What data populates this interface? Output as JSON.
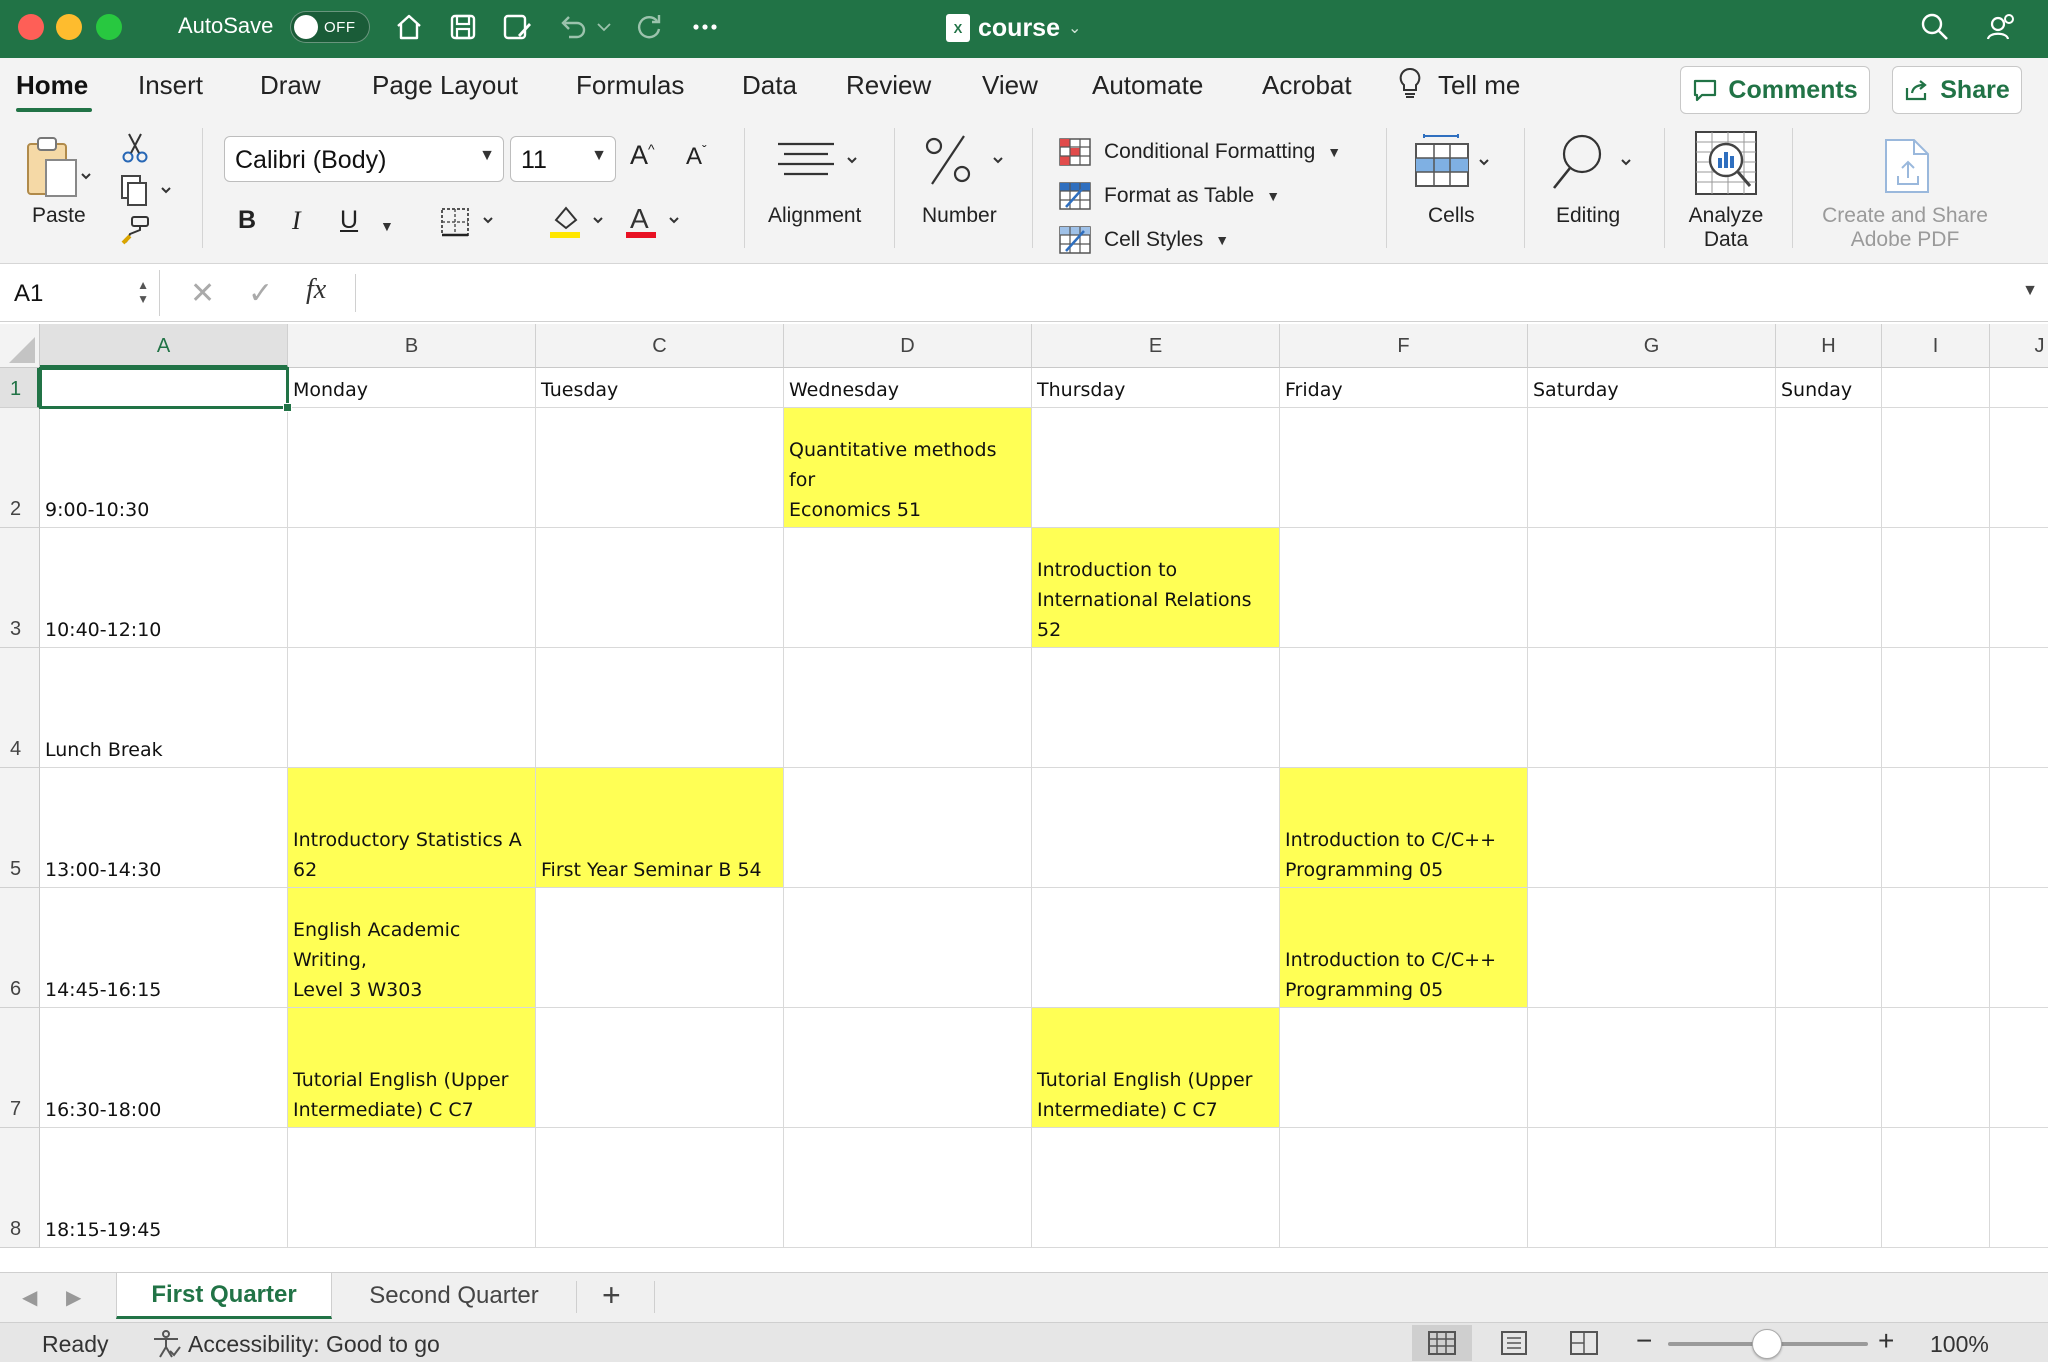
{
  "window": {
    "title": "course",
    "autosave_label": "AutoSave",
    "autosave_state": "OFF"
  },
  "ribbon_tabs": [
    {
      "label": "Home",
      "active": true
    },
    {
      "label": "Insert"
    },
    {
      "label": "Draw"
    },
    {
      "label": "Page Layout"
    },
    {
      "label": "Formulas"
    },
    {
      "label": "Data"
    },
    {
      "label": "Review"
    },
    {
      "label": "View"
    },
    {
      "label": "Automate"
    },
    {
      "label": "Acrobat"
    },
    {
      "label": "Tell me"
    }
  ],
  "ribbon_buttons": {
    "comments": "Comments",
    "share": "Share"
  },
  "ribbon": {
    "paste": "Paste",
    "font_name": "Calibri (Body)",
    "font_size": "11",
    "bold": "B",
    "italic": "I",
    "underline": "U",
    "alignment": "Alignment",
    "number": "Number",
    "conditional_formatting": "Conditional Formatting",
    "format_as_table": "Format as Table",
    "cell_styles": "Cell Styles",
    "cells": "Cells",
    "editing": "Editing",
    "analyze_data": "Analyze Data",
    "adobe_pdf": "Create and Share Adobe PDF"
  },
  "formula_bar": {
    "name_box": "A1",
    "fx": "fx",
    "content": ""
  },
  "columns": [
    "A",
    "B",
    "C",
    "D",
    "E",
    "F",
    "G",
    "H",
    "I",
    "J"
  ],
  "rows": [
    "1",
    "2",
    "3",
    "4",
    "5",
    "6",
    "7",
    "8"
  ],
  "sheet": {
    "days": [
      "Monday",
      "Tuesday",
      "Wednesday",
      "Thursday",
      "Friday",
      "Saturday",
      "Sunday"
    ],
    "times": [
      "9:00-10:30",
      "10:40-12:10",
      "Lunch Break",
      "13:00-14:30",
      "14:45-16:15",
      "16:30-18:00",
      "18:15-19:45"
    ],
    "classes": [
      {
        "cell": "D2",
        "text": "Quantitative methods for\nEconomics 51"
      },
      {
        "cell": "E3",
        "text": "Introduction to\nInternational Relations 52"
      },
      {
        "cell": "B5",
        "text": "Introductory Statistics A\n62"
      },
      {
        "cell": "C5",
        "text": "First Year Seminar B 54"
      },
      {
        "cell": "F5",
        "text": "Introduction to C/C++\nProgramming 05"
      },
      {
        "cell": "B6",
        "text": "English Academic Writing,\nLevel 3 W303"
      },
      {
        "cell": "F6",
        "text": "Introduction to C/C++\nProgramming 05"
      },
      {
        "cell": "B7",
        "text": "Tutorial English (Upper\nIntermediate) C C7"
      },
      {
        "cell": "E7",
        "text": "Tutorial English (Upper\nIntermediate) C C7"
      }
    ],
    "highlight_color": "#ffff55",
    "active_cell": "A1"
  },
  "sheet_tabs": [
    {
      "label": "First Quarter",
      "active": true
    },
    {
      "label": "Second Quarter"
    }
  ],
  "status_bar": {
    "ready": "Ready",
    "accessibility": "Accessibility: Good to go",
    "zoom": "100%"
  },
  "colors": {
    "accent": "#217346",
    "highlight": "#ffff55"
  }
}
